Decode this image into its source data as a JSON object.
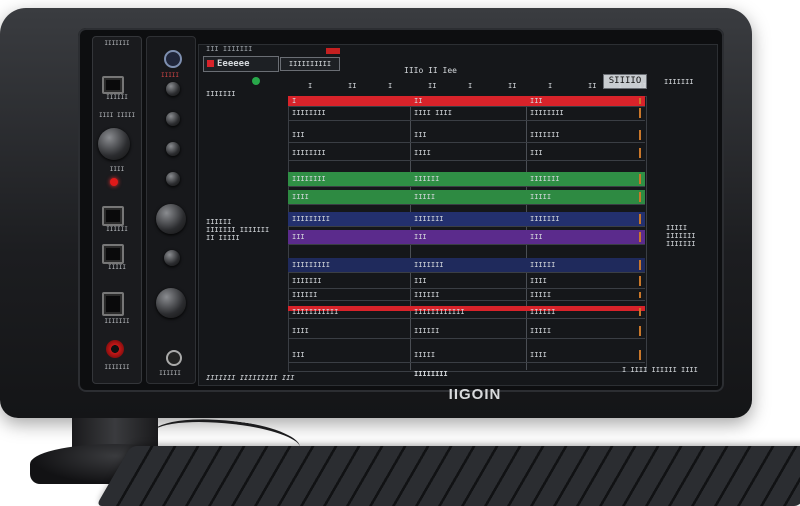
{
  "brand": "IIGOIN",
  "strip": {
    "top_label": "IIIIIII",
    "port1_label": "IIIIII",
    "port1_sub": "IIII IIIII",
    "knob_label": "IIII",
    "port2_label": "IIIIII",
    "port3_label": "IIIII",
    "port4_label": "IIIIIII",
    "red_jack_label": "IIIIIII"
  },
  "strip2": {
    "top_label": "IIIII",
    "bottom_label": "IIIIII"
  },
  "screen": {
    "title": "Eeeeee",
    "top_left_text": "III IIIIIII",
    "tab2": "IIIIIIIIII",
    "tab3": "IIIo    II  Iee",
    "right_box": "SIIIIO",
    "right_text": "IIIIIII",
    "col_markers": [
      "I",
      "II",
      "I",
      "II",
      "I",
      "II",
      "I",
      "II",
      "I",
      "II"
    ],
    "side_left": "IIIIIII",
    "side_left_mid1": "IIIIII",
    "side_left_mid2": "IIIIIII IIIIIII",
    "side_left_mid3": "II IIIII",
    "side_right1": "IIIII",
    "side_right2": "IIIIIII",
    "side_right3": "IIIIIII",
    "bottom_left": "IIIIIII IIIIIIIII III",
    "bottom_center": "IIIIIIII",
    "bottom_right": "I IIII IIIIII IIII"
  },
  "rows": [
    {
      "c1": "I",
      "c2": "II",
      "c3": "III"
    },
    {
      "c1": "IIIIIIII",
      "c2": "IIII IIII",
      "c3": "IIIIIIII"
    },
    {
      "c1": "III",
      "c2": "III",
      "c3": "IIIIIII"
    },
    {
      "c1": "IIIIIIII",
      "c2": "IIII",
      "c3": "III"
    },
    {
      "c1": "IIIIIIII",
      "c2": "IIIIII",
      "c3": "IIIIIII"
    },
    {
      "c1": "IIII",
      "c2": "IIIII",
      "c3": "IIIII"
    },
    {
      "c1": "IIIIIIIII",
      "c2": "IIIIIII",
      "c3": "IIIIIII"
    },
    {
      "c1": "III",
      "c2": "III",
      "c3": "III"
    },
    {
      "c1": "IIIIIIIII",
      "c2": "IIIIIII",
      "c3": "IIIIII"
    },
    {
      "c1": "IIIIIII",
      "c2": "III",
      "c3": "IIII"
    },
    {
      "c1": "IIIIII",
      "c2": "IIIIII",
      "c3": "IIIII"
    },
    {
      "c1": "IIIIIIIIIII",
      "c2": "IIIIIIIIIIII",
      "c3": "IIIIII"
    },
    {
      "c1": "IIII",
      "c2": "IIIIII",
      "c3": "IIIII"
    },
    {
      "c1": "III",
      "c2": "IIIII",
      "c3": "IIII"
    }
  ],
  "colors": {
    "red": "#d8232a",
    "green": "#2f8f45",
    "blue": "#23306e",
    "purple": "#5b2b8c",
    "navy": "#1f2a5c"
  }
}
